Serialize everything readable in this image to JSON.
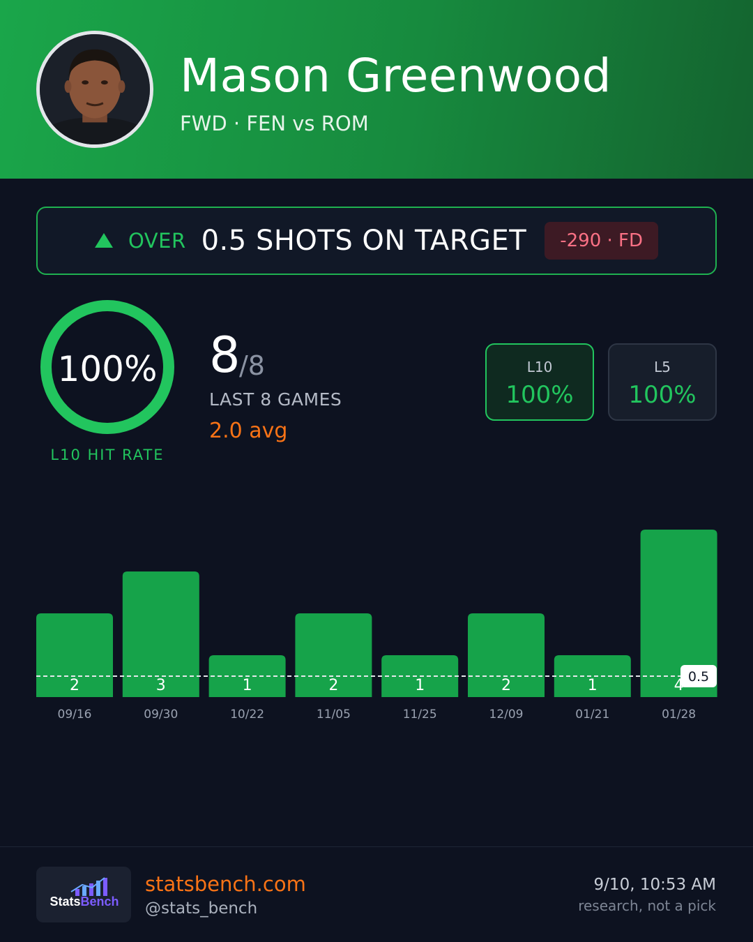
{
  "header": {
    "player_name": "Mason Greenwood",
    "subtitle": "FWD · FEN vs ROM"
  },
  "prop": {
    "direction": "OVER",
    "line_text": "0.5 SHOTS ON TARGET",
    "odds_text": "-290 · FD"
  },
  "hit_rate": {
    "value": "100%",
    "fraction": 1.0,
    "label": "L10 HIT RATE"
  },
  "record": {
    "hits": "8",
    "total": "/8",
    "label": "LAST 8 GAMES",
    "avg": "2.0 avg"
  },
  "windows": [
    {
      "label": "L10",
      "value": "100%"
    },
    {
      "label": "L5",
      "value": "100%"
    }
  ],
  "colors": {
    "hit": "#16a34a",
    "accent": "#22c55e",
    "odds": "#fb7185",
    "avg": "#f97316"
  },
  "chart_data": {
    "type": "bar",
    "categories": [
      "09/16",
      "09/30",
      "10/22",
      "11/05",
      "11/25",
      "12/09",
      "01/21",
      "01/28"
    ],
    "values": [
      2,
      3,
      1,
      2,
      1,
      2,
      1,
      4
    ],
    "line": 0.5,
    "line_label": "0.5",
    "ylim": [
      0,
      4
    ],
    "grid": false
  },
  "footer": {
    "logo_text_a": "Stats",
    "logo_text_b": "Bench",
    "site": "statsbench.com",
    "handle": "@stats_bench",
    "timestamp": "9/10, 10:53 AM",
    "disclaimer": "research, not a pick"
  }
}
